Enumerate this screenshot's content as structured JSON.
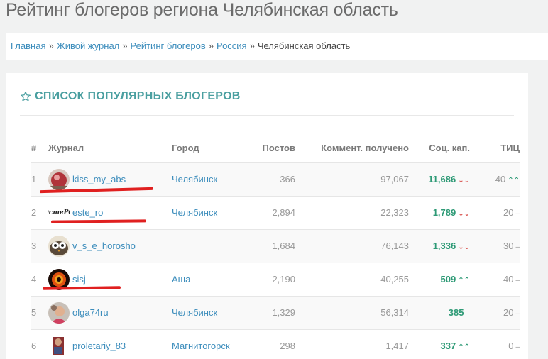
{
  "page": {
    "title": "Рейтинг блогеров региона Челябинская область"
  },
  "breadcrumb": {
    "items": [
      "Главная",
      "Живой журнал",
      "Рейтинг блогеров",
      "Россия"
    ],
    "separator": "»",
    "current": "Челябинская область"
  },
  "panel": {
    "title": "СПИСОК ПОПУЛЯРНЫХ БЛОГЕРОВ",
    "icon": "star-outline-icon"
  },
  "table": {
    "headers": {
      "idx": "#",
      "journal": "Журнал",
      "city": "Город",
      "posts": "Постов",
      "comments": "Коммент. получено",
      "soc": "Соц. кап.",
      "tic": "ТИЦ"
    },
    "rows": [
      {
        "idx": "1",
        "name": "kiss_my_abs",
        "city": "Челябинск",
        "posts": "366",
        "comments": "97,067",
        "soc": "11,686",
        "soc_trend": "⌄⌄",
        "tic": "40",
        "tic_trend": "⌃⌃"
      },
      {
        "idx": "2",
        "name": "este_ro",
        "city": "Челябинск",
        "posts": "2,894",
        "comments": "22,323",
        "soc": "1,789",
        "soc_trend": "⌄⌄",
        "tic": "20",
        "tic_trend": "–"
      },
      {
        "idx": "3",
        "name": "v_s_e_horosho",
        "city": "",
        "posts": "1,684",
        "comments": "76,143",
        "soc": "1,336",
        "soc_trend": "⌄⌄",
        "tic": "30",
        "tic_trend": "–"
      },
      {
        "idx": "4",
        "name": "sisj",
        "city": "Аша",
        "posts": "2,190",
        "comments": "40,255",
        "soc": "509",
        "soc_trend": "⌃⌃",
        "tic": "40",
        "tic_trend": "–"
      },
      {
        "idx": "5",
        "name": "olga74ru",
        "city": "Челябинск",
        "posts": "1,329",
        "comments": "56,314",
        "soc": "385",
        "soc_trend": "–",
        "tic": "20",
        "tic_trend": "–"
      },
      {
        "idx": "6",
        "name": "proletariy_83",
        "city": "Магнитогорск",
        "posts": "298",
        "comments": "1,417",
        "soc": "337",
        "soc_trend": "⌃⌃",
        "tic": "0",
        "tic_trend": "–"
      }
    ],
    "avatar_labels": {
      "este_ro": "ЭстеРО"
    }
  },
  "colors": {
    "link": "#3c8dbc",
    "accent": "#4a9fa0",
    "up": "#2e9a76",
    "down": "#d9534f",
    "annotation": "#e02020"
  }
}
